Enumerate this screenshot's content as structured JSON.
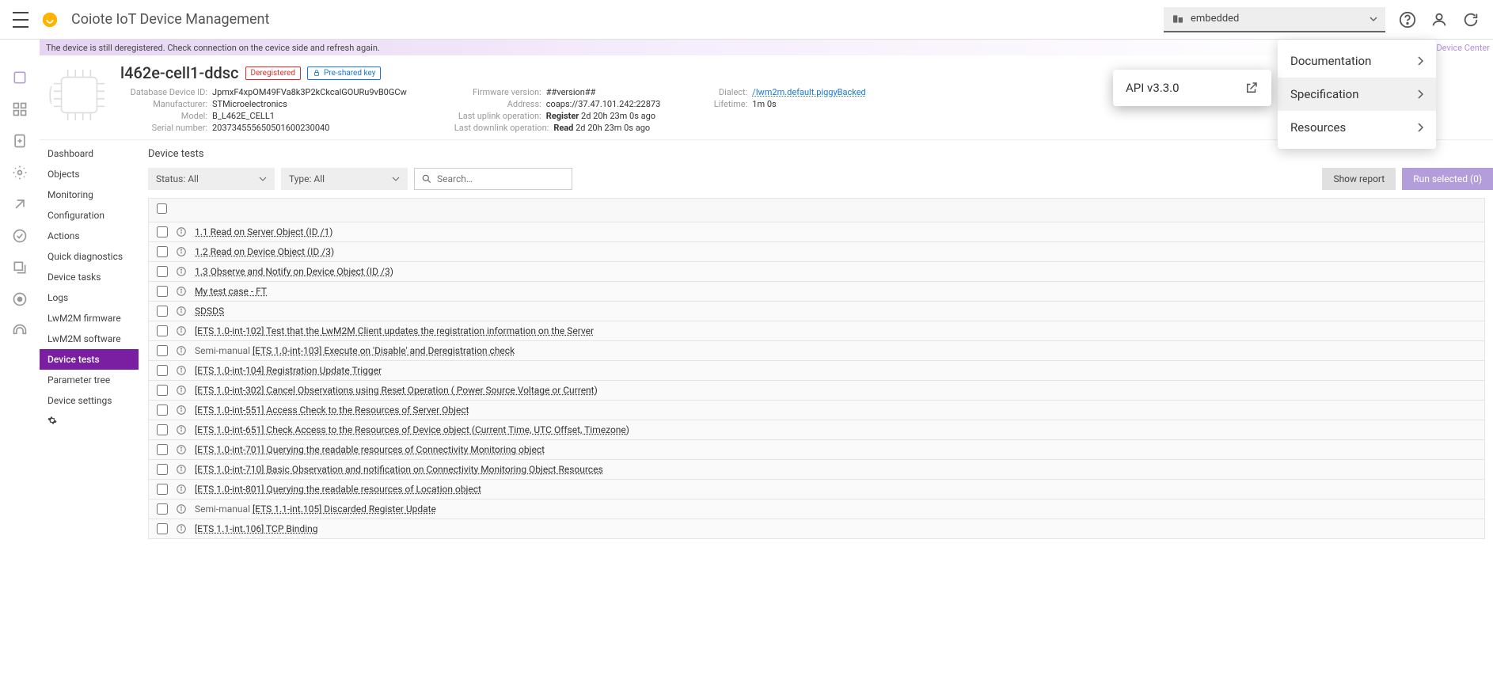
{
  "topbar": {
    "title": "Coiote IoT Device Management",
    "domain_selected": "embedded"
  },
  "alert": "The device is still deregistered. Check connection on the cevice side and refresh again.",
  "new_device_center": "new Device Center",
  "device": {
    "name": "l462e-cell1-ddsc",
    "status_badge": "Deregistered",
    "security_badge": "Pre-shared key",
    "meta": {
      "db_id_label": "Database Device ID:",
      "db_id": "JpmxF4xpOM49FVa8k3P2kCkcalGOURu9vB0GCw",
      "manufacturer_label": "Manufacturer:",
      "manufacturer": "STMicroelectronics",
      "model_label": "Model:",
      "model": "B_L462E_CELL1",
      "serial_label": "Serial number:",
      "serial": "203734555650501600230040",
      "fw_label": "Firmware version:",
      "fw": "##version##",
      "addr_label": "Address:",
      "addr": "coaps://37.47.101.242:22873",
      "last_up_label": "Last uplink operation:",
      "last_up_op": "Register",
      "last_up_time": "2d 20h 23m 0s ago",
      "last_dn_label": "Last downlink operation:",
      "last_dn_op": "Read",
      "last_dn_time": "2d 20h 23m 0s ago",
      "dialect_label": "Dialect:",
      "dialect": "/lwm2m.default.piggyBacked",
      "lifetime_label": "Lifetime:",
      "lifetime": "1m 0s"
    }
  },
  "sidenav": {
    "items": [
      "Dashboard",
      "Objects",
      "Monitoring",
      "Configuration",
      "Actions",
      "Quick diagnostics",
      "Device tasks",
      "Logs",
      "LwM2M firmware",
      "LwM2M software",
      "Device tests",
      "Parameter tree",
      "Device settings"
    ],
    "active_index": 10
  },
  "panel": {
    "title": "Device tests",
    "status_filter": "Status: All",
    "type_filter": "Type: All",
    "search_placeholder": "Search…",
    "show_report": "Show report",
    "run_selected": "Run selected (0)"
  },
  "tests": [
    {
      "semi": false,
      "name": "1.1 Read on Server Object (ID /1)"
    },
    {
      "semi": false,
      "name": "1.2 Read on Device Object (ID /3)"
    },
    {
      "semi": false,
      "name": "1.3 Observe and Notify on Device Object (ID /3)"
    },
    {
      "semi": false,
      "name": "My test case - FT"
    },
    {
      "semi": false,
      "name": "SDSDS"
    },
    {
      "semi": false,
      "name": "[ETS 1.0-int-102] Test that the LwM2M Client updates the registration information on the Server"
    },
    {
      "semi": true,
      "name": "[ETS 1.0-int-103] Execute on 'Disable' and Deregistration check"
    },
    {
      "semi": false,
      "name": "[ETS 1.0-int-104] Registration Update Trigger"
    },
    {
      "semi": false,
      "name": "[ETS 1.0-int-302] Cancel Observations using Reset Operation ( Power Source Voltage or Current)"
    },
    {
      "semi": false,
      "name": "[ETS 1.0-int-551] Access Check to the Resources of Server Object"
    },
    {
      "semi": false,
      "name": "[ETS 1.0-int-651] Check Access to the Resources of Device object (Current Time, UTC Offset, Timezone)"
    },
    {
      "semi": false,
      "name": "[ETS 1.0-int-701] Querying the readable resources of Connectivity Monitoring object"
    },
    {
      "semi": false,
      "name": "[ETS 1.0-int-710] Basic Observation and notification on Connectivity Monitoring Object Resources"
    },
    {
      "semi": false,
      "name": "[ETS 1.0-int-801] Querying the readable resources of Location object"
    },
    {
      "semi": true,
      "name": "[ETS 1.1-int.105] Discarded Register Update"
    },
    {
      "semi": false,
      "name": "[ETS 1.1-int.106] TCP Binding"
    }
  ],
  "help_menu": {
    "items": [
      "Documentation",
      "Specification",
      "Resources"
    ],
    "api_label": "API v3.3.0",
    "semi_manual_label": "Semi-manual"
  }
}
